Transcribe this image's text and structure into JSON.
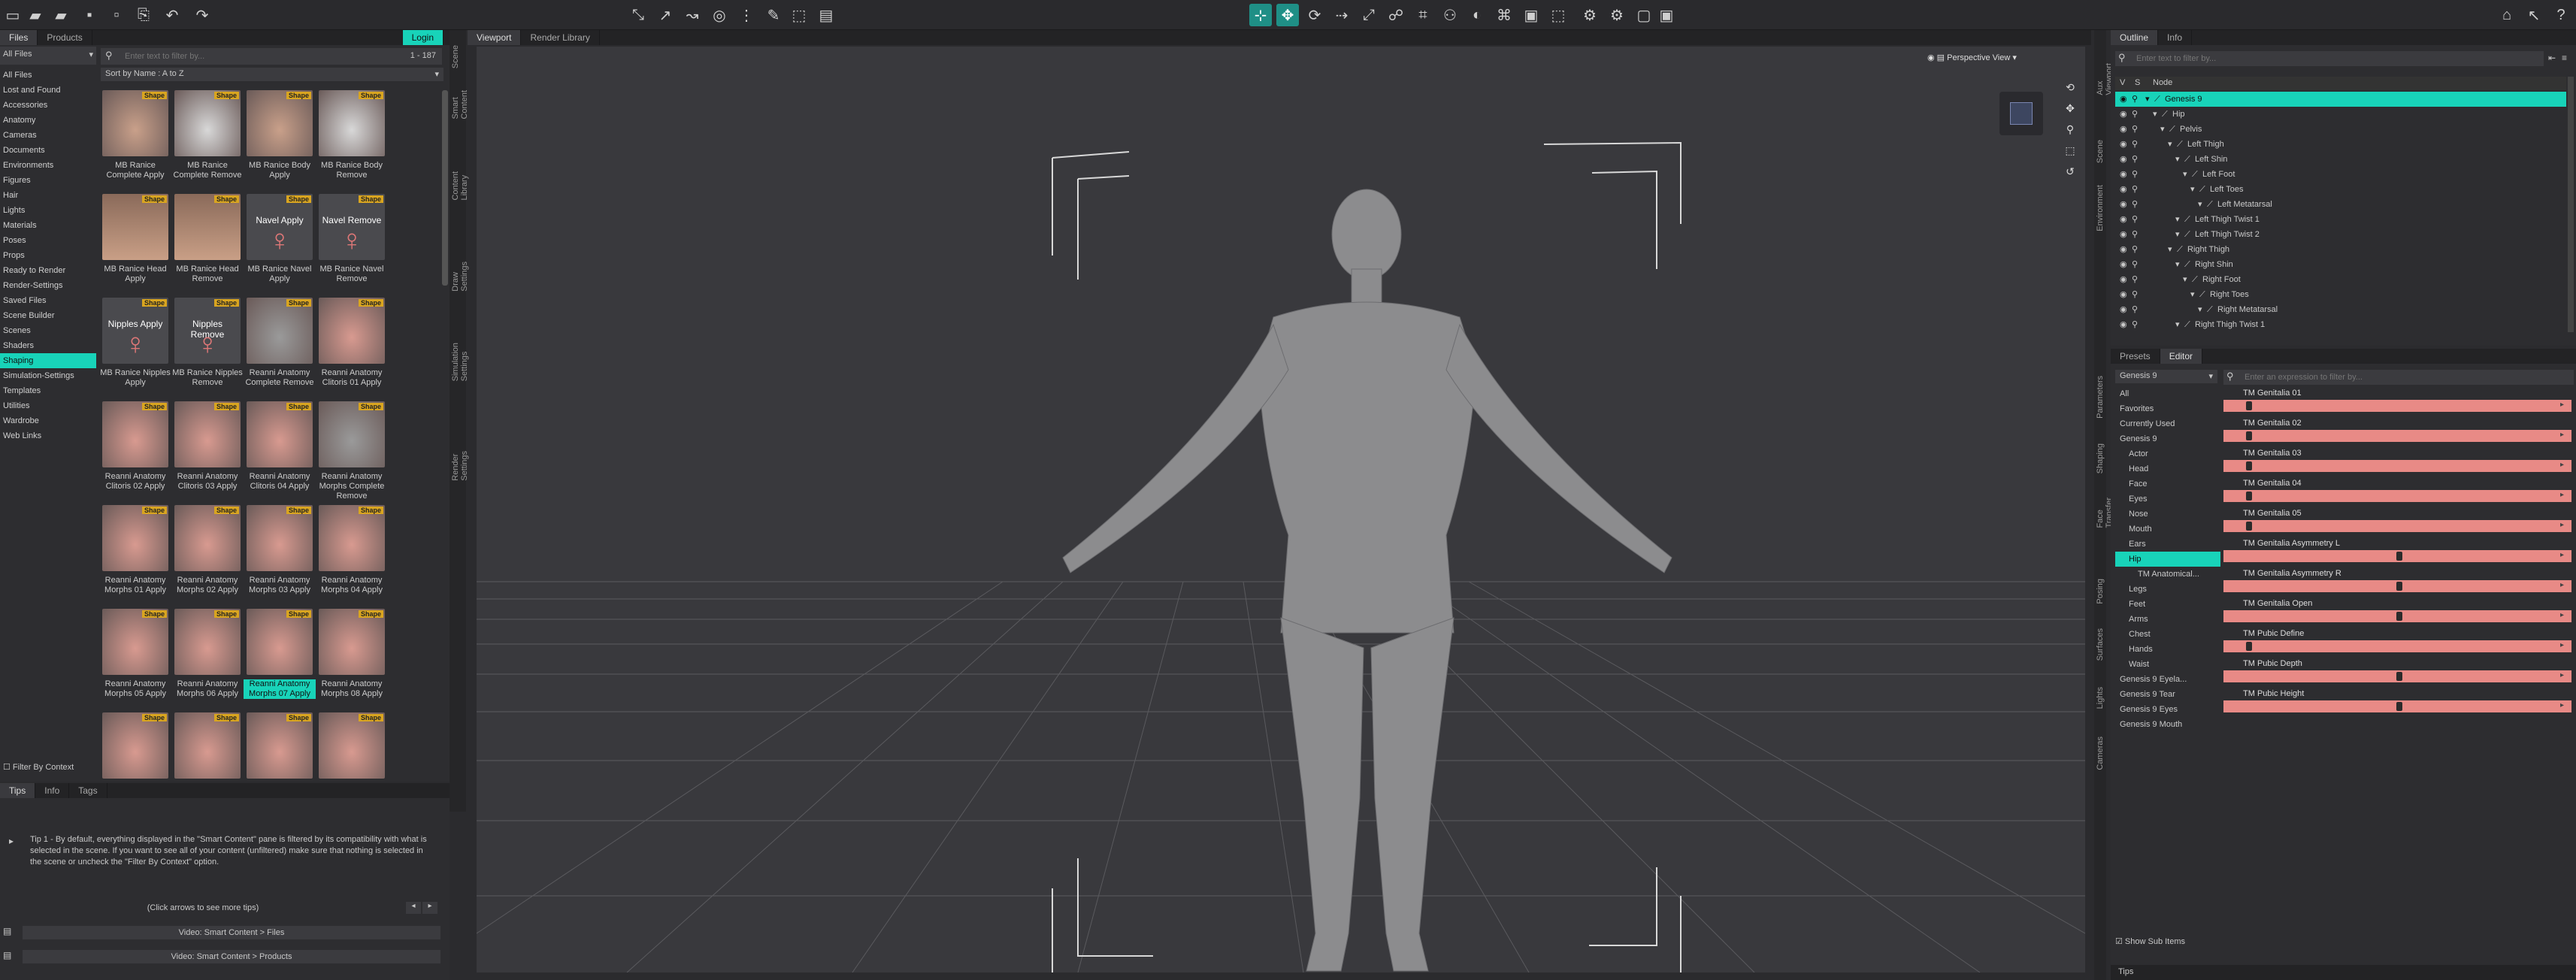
{
  "toolbar": {
    "icons": [
      "new-file",
      "open-folder",
      "open-recent",
      "save",
      "save-as",
      "merge",
      "undo",
      "redo",
      "import",
      "node-select",
      "transform",
      "rotate",
      "scale",
      "translate",
      "universal",
      "geometry",
      "joint",
      "surface",
      "lights",
      "render",
      "camera",
      "aux"
    ]
  },
  "left": {
    "tabs": [
      "Files",
      "Products"
    ],
    "login": "Login",
    "dropdown": "All Files",
    "categories": [
      "All Files",
      "Lost and Found",
      "Accessories",
      "Anatomy",
      "Cameras",
      "Documents",
      "Environments",
      "Figures",
      "Hair",
      "Lights",
      "Materials",
      "Poses",
      "Props",
      "Ready to Render",
      "Render-Settings",
      "Saved Files",
      "Scene Builder",
      "Scenes",
      "Shaders",
      "Shaping",
      "Simulation-Settings",
      "Templates",
      "Utilities",
      "Wardrobe",
      "Web Links"
    ],
    "selected_category": "Shaping",
    "search_placeholder": "Enter text to filter by...",
    "count": "1 - 187",
    "sort": "Sort by Name : A to Z",
    "filter_context": "Filter By Context",
    "vtabs": [
      "Scene",
      "Smart Content",
      "Content Library",
      "Draw Settings",
      "Simulation Settings",
      "Render Settings"
    ],
    "thumbs": [
      {
        "l1": "MB Ranice",
        "l2": "Complete Apply",
        "kind": "skin"
      },
      {
        "l1": "MB Ranice",
        "l2": "Complete Remove",
        "kind": "white"
      },
      {
        "l1": "MB Ranice Body",
        "l2": "Apply",
        "kind": "skin"
      },
      {
        "l1": "MB Ranice Body",
        "l2": "Remove",
        "kind": "white"
      },
      {
        "l1": "MB Ranice Head",
        "l2": "Apply",
        "kind": "face"
      },
      {
        "l1": "MB Ranice Head",
        "l2": "Remove",
        "kind": "face"
      },
      {
        "l1": "MB Ranice Navel",
        "l2": "Apply",
        "kind": "sign",
        "sign": "Navel Apply"
      },
      {
        "l1": "MB Ranice Navel",
        "l2": "Remove",
        "kind": "sign",
        "sign": "Navel Remove"
      },
      {
        "l1": "MB Ranice Nipples",
        "l2": "Apply",
        "kind": "sign",
        "sign": "Nipples Apply"
      },
      {
        "l1": "MB Ranice Nipples",
        "l2": "Remove",
        "kind": "sign",
        "sign": "Nipples Remove"
      },
      {
        "l1": "Reanni Anatomy",
        "l2": "Complete Remove",
        "kind": "grey"
      },
      {
        "l1": "Reanni Anatomy",
        "l2": "Clitoris 01 Apply",
        "kind": "pink"
      },
      {
        "l1": "Reanni Anatomy",
        "l2": "Clitoris 02 Apply",
        "kind": "pink"
      },
      {
        "l1": "Reanni Anatomy",
        "l2": "Clitoris 03 Apply",
        "kind": "pink"
      },
      {
        "l1": "Reanni Anatomy",
        "l2": "Clitoris 04 Apply",
        "kind": "pink"
      },
      {
        "l1": "Reanni Anatomy",
        "l2": "Morphs Complete",
        "l3": "Remove",
        "kind": "grey"
      },
      {
        "l1": "Reanni Anatomy",
        "l2": "Morphs 01 Apply",
        "kind": "pink"
      },
      {
        "l1": "Reanni Anatomy",
        "l2": "Morphs 02 Apply",
        "kind": "pink"
      },
      {
        "l1": "Reanni Anatomy",
        "l2": "Morphs 03 Apply",
        "kind": "pink"
      },
      {
        "l1": "Reanni Anatomy",
        "l2": "Morphs 04 Apply",
        "kind": "pink"
      },
      {
        "l1": "Reanni Anatomy",
        "l2": "Morphs 05 Apply",
        "kind": "pink"
      },
      {
        "l1": "Reanni Anatomy",
        "l2": "Morphs 06 Apply",
        "kind": "pink"
      },
      {
        "l1": "Reanni Anatomy",
        "l2": "Morphs 07 Apply",
        "kind": "pink",
        "sel": true
      },
      {
        "l1": "Reanni Anatomy",
        "l2": "Morphs 08 Apply",
        "kind": "pink"
      },
      {
        "l1": "",
        "l2": "",
        "kind": "pink"
      },
      {
        "l1": "",
        "l2": "",
        "kind": "pink"
      },
      {
        "l1": "",
        "l2": "",
        "kind": "pink"
      },
      {
        "l1": "",
        "l2": "",
        "kind": "pink"
      }
    ],
    "badge": "Shape",
    "colors": {
      "pink": "#d89a90",
      "skin": "#c9a08a",
      "grey": "#9a9a9a",
      "white": "#d8d8d8"
    }
  },
  "tips": {
    "tabs": [
      "Tips",
      "Info",
      "Tags"
    ],
    "text": "Tip 1 - By default, everything displayed in the \"Smart Content\" pane is filtered by its compatibility with what is selected in the scene. If you want to see all of your content (unfiltered) make sure that nothing is selected in the scene or uncheck the \"Filter By Context\" option.",
    "more": "(Click arrows to see more tips)",
    "btn1": "Video: Smart Content > Files",
    "btn2": "Video: Smart Content > Products"
  },
  "viewport": {
    "tabs": [
      "Viewport",
      "Render Library"
    ],
    "view": "Perspective View"
  },
  "right": {
    "vtabs": [
      "Aux Viewport",
      "Scene",
      "Environment"
    ],
    "tabs": [
      "Outline",
      "Info"
    ],
    "search_placeholder": "Enter text to filter by...",
    "header": {
      "v": "V",
      "s": "S",
      "node": "Node"
    },
    "nodes": [
      {
        "name": "Genesis 9",
        "d": 0,
        "sel": true
      },
      {
        "name": "Hip",
        "d": 1
      },
      {
        "name": "Pelvis",
        "d": 2
      },
      {
        "name": "Left Thigh",
        "d": 3
      },
      {
        "name": "Left Shin",
        "d": 4
      },
      {
        "name": "Left Foot",
        "d": 5
      },
      {
        "name": "Left Toes",
        "d": 6
      },
      {
        "name": "Left Metatarsal",
        "d": 7
      },
      {
        "name": "Left Thigh Twist 1",
        "d": 4
      },
      {
        "name": "Left Thigh Twist 2",
        "d": 4
      },
      {
        "name": "Right Thigh",
        "d": 3
      },
      {
        "name": "Right Shin",
        "d": 4
      },
      {
        "name": "Right Foot",
        "d": 5
      },
      {
        "name": "Right Toes",
        "d": 6
      },
      {
        "name": "Right Metatarsal",
        "d": 7
      },
      {
        "name": "Right Thigh Twist 1",
        "d": 4
      }
    ]
  },
  "shaping": {
    "tabs": [
      "Presets",
      "Editor"
    ],
    "vtabs": [
      "Parameters",
      "Shaping",
      "Face Transfer",
      "Posing",
      "Surfaces",
      "Lights",
      "Cameras"
    ],
    "figure": "Genesis 9",
    "filter_placeholder": "Enter an expression to filter by...",
    "show_sub": "Show Sub Items",
    "groups": [
      {
        "name": "All",
        "d": 0
      },
      {
        "name": "Favorites",
        "d": 0
      },
      {
        "name": "Currently Used",
        "d": 0
      },
      {
        "name": "Genesis 9",
        "d": 0
      },
      {
        "name": "Actor",
        "d": 1
      },
      {
        "name": "Head",
        "d": 1
      },
      {
        "name": "Face",
        "d": 1
      },
      {
        "name": "Eyes",
        "d": 1
      },
      {
        "name": "Nose",
        "d": 1
      },
      {
        "name": "Mouth",
        "d": 1
      },
      {
        "name": "Ears",
        "d": 1
      },
      {
        "name": "Hip",
        "d": 1,
        "sel": true
      },
      {
        "name": "TM Anatomical...",
        "d": 2
      },
      {
        "name": "Legs",
        "d": 1
      },
      {
        "name": "Feet",
        "d": 1
      },
      {
        "name": "Arms",
        "d": 1
      },
      {
        "name": "Chest",
        "d": 1
      },
      {
        "name": "Hands",
        "d": 1
      },
      {
        "name": "Waist",
        "d": 1
      },
      {
        "name": "Genesis 9 Eyela...",
        "d": 0
      },
      {
        "name": "Genesis 9 Tear",
        "d": 0
      },
      {
        "name": "Genesis 9 Eyes",
        "d": 0
      },
      {
        "name": "Genesis 9 Mouth",
        "d": 0
      }
    ],
    "params": [
      {
        "name": "TM Genitalia 01",
        "value": 0.0
      },
      {
        "name": "TM Genitalia 02",
        "value": 0.0
      },
      {
        "name": "TM Genitalia 03",
        "value": 0.0
      },
      {
        "name": "TM Genitalia 04",
        "value": 0.0
      },
      {
        "name": "TM Genitalia 05",
        "value": 0.0
      },
      {
        "name": "TM Genitalia Asymmetry L",
        "value": 0.5
      },
      {
        "name": "TM Genitalia Asymmetry R",
        "value": 0.5
      },
      {
        "name": "TM Genitalia Open",
        "value": 0.5
      },
      {
        "name": "TM Pubic Define",
        "value": 0.0
      },
      {
        "name": "TM Pubic Depth",
        "value": 0.5
      },
      {
        "name": "TM Pubic Height",
        "value": 0.5
      }
    ]
  },
  "status": {
    "tips": "Tips"
  }
}
